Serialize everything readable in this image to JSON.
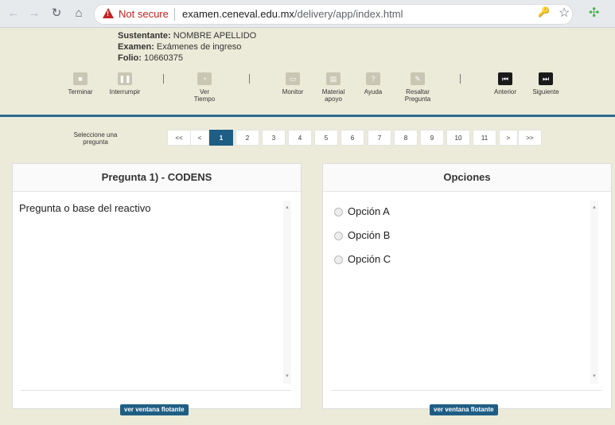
{
  "browser": {
    "security": "Not secure",
    "url_host": "examen.ceneval.edu.mx",
    "url_path": "/delivery/app/index.html"
  },
  "exam_info": {
    "sustentante_label": "Sustentante:",
    "sustentante_value": "NOMBRE APELLIDO",
    "examen_label": "Examen:",
    "examen_value": "Exámenes de ingreso",
    "folio_label": "Folio:",
    "folio_value": "10660375"
  },
  "toolbar": {
    "terminar": "Terminar",
    "interrumpir": "Interrumpir",
    "ver_tiempo_1": "Ver",
    "ver_tiempo_2": "Tiempo",
    "monitor": "Monitor",
    "material_1": "Material",
    "material_2": "apoyo",
    "ayuda": "Ayuda",
    "resaltar_1": "Resaltar",
    "resaltar_2": "Pregunta",
    "anterior": "Anterior",
    "siguiente": "Siguiente"
  },
  "pager": {
    "label_1": "Seleccione una",
    "label_2": "pregunta",
    "first": "<<",
    "prev": "<",
    "pages": [
      "1",
      "2",
      "3",
      "4",
      "5",
      "6",
      "7",
      "8",
      "9",
      "10",
      "11"
    ],
    "current": "1",
    "next": ">",
    "last": ">>"
  },
  "question_panel": {
    "title": "Pregunta 1) - CODENS",
    "text": "Pregunta o base del reactivo",
    "float_button": "ver ventana flotante"
  },
  "options_panel": {
    "title": "Opciones",
    "options": [
      "Opción A",
      "Opción B",
      "Opción C"
    ],
    "float_button": "ver ventana flotante"
  },
  "colors": {
    "header_bg": "#ecebd9",
    "accent": "#1f5e84",
    "warning": "#c5221f"
  }
}
